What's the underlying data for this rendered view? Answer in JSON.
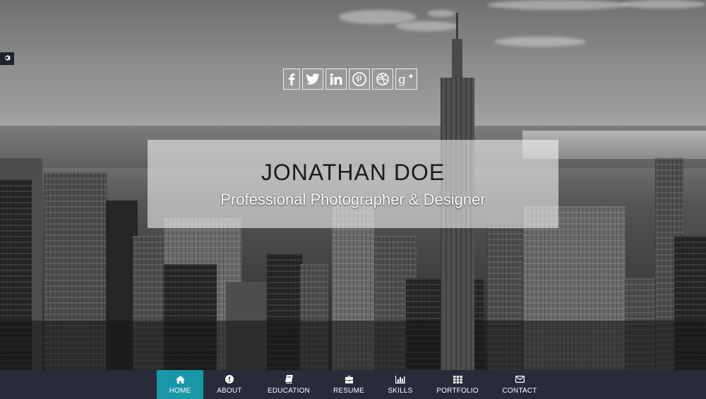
{
  "hero": {
    "name": "JONATHAN DOE",
    "tagline": "Professional Photographer & Designer"
  },
  "settings": {
    "icon": "gear-icon"
  },
  "social_links": [
    {
      "id": "facebook",
      "icon": "facebook-icon"
    },
    {
      "id": "twitter",
      "icon": "twitter-icon"
    },
    {
      "id": "linkedin",
      "icon": "linkedin-icon"
    },
    {
      "id": "pinterest",
      "icon": "pinterest-icon"
    },
    {
      "id": "dribbble",
      "icon": "dribbble-icon"
    },
    {
      "id": "google-plus",
      "icon": "google-plus-icon"
    }
  ],
  "nav": {
    "items": [
      {
        "label": "HOME",
        "icon": "home-icon",
        "active": true
      },
      {
        "label": "ABOUT",
        "icon": "info-icon",
        "active": false
      },
      {
        "label": "EDUCATION",
        "icon": "book-icon",
        "active": false
      },
      {
        "label": "RESUME",
        "icon": "briefcase-icon",
        "active": false
      },
      {
        "label": "SKILLS",
        "icon": "bar-chart-icon",
        "active": false
      },
      {
        "label": "PORTFOLIO",
        "icon": "grid-icon",
        "active": false
      },
      {
        "label": "CONTACT",
        "icon": "envelope-icon",
        "active": false
      }
    ]
  },
  "colors": {
    "nav_background": "#272b3a",
    "nav_active": "#1a97a6",
    "nav_text": "#ffffff"
  }
}
